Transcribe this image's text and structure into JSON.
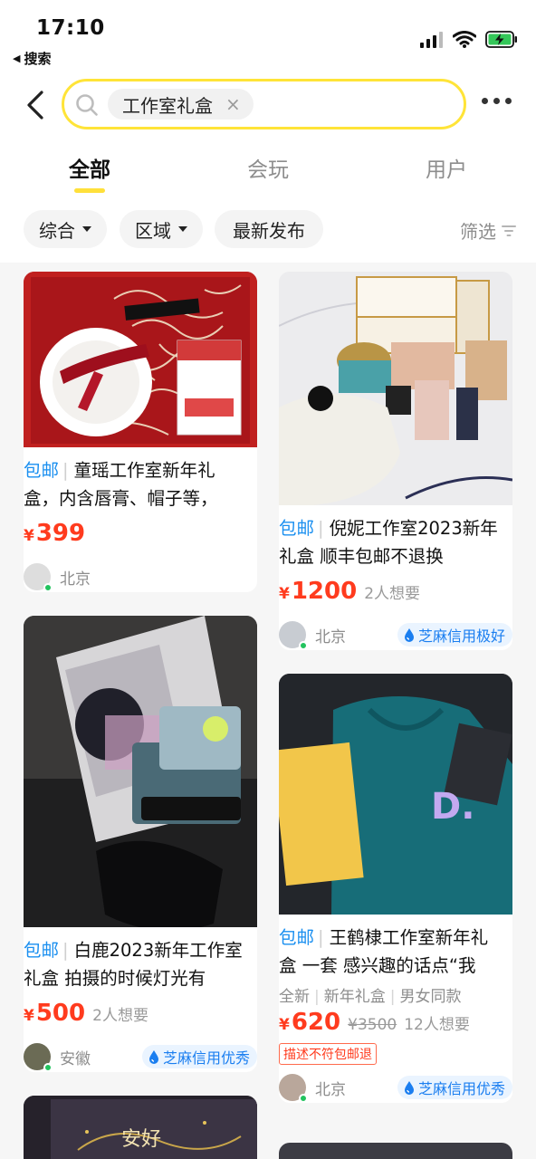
{
  "status_bar": {
    "time": "17:10",
    "back_app": "搜索"
  },
  "search": {
    "query": "工作室礼盒",
    "clear_glyph": "×"
  },
  "tabs": [
    {
      "label": "全部"
    },
    {
      "label": "会玩"
    },
    {
      "label": "用户"
    }
  ],
  "filters": {
    "sort": "综合",
    "region": "区域",
    "latest": "最新发布",
    "filter": "筛选"
  },
  "items": [
    {
      "tag": "包邮",
      "title": "童瑶工作室新年礼盒，内含唇膏、帽子等，",
      "currency": "¥",
      "price": "399",
      "location": "北京"
    },
    {
      "tag": "包邮",
      "title": "倪妮工作室2023新年礼盒 顺丰包邮不退换",
      "currency": "¥",
      "price": "1200",
      "wants": "2人想要",
      "location": "北京",
      "credit": "芝麻信用极好"
    },
    {
      "tag": "包邮",
      "title": "白鹿2023新年工作室礼盒 拍摄的时候灯光有",
      "currency": "¥",
      "price": "500",
      "wants": "2人想要",
      "location": "安徽",
      "credit": "芝麻信用优秀"
    },
    {
      "tag": "包邮",
      "title": "王鹤棣工作室新年礼盒 一套 感兴趣的话点“我",
      "attrs": [
        "全新",
        "新年礼盒",
        "男女同款"
      ],
      "currency": "¥",
      "price": "620",
      "original_price": "¥3500",
      "wants": "12人想要",
      "warning": "描述不符包邮退",
      "location": "北京",
      "credit": "芝麻信用优秀"
    }
  ],
  "photo_text": {
    "box5": "安好",
    "hoodie_letter": "D."
  },
  "colors": {
    "accent_yellow": "#ffe438",
    "price_red": "#ff3b1e",
    "free_ship_blue": "#1a8ff0",
    "online_green": "#22c35e"
  }
}
